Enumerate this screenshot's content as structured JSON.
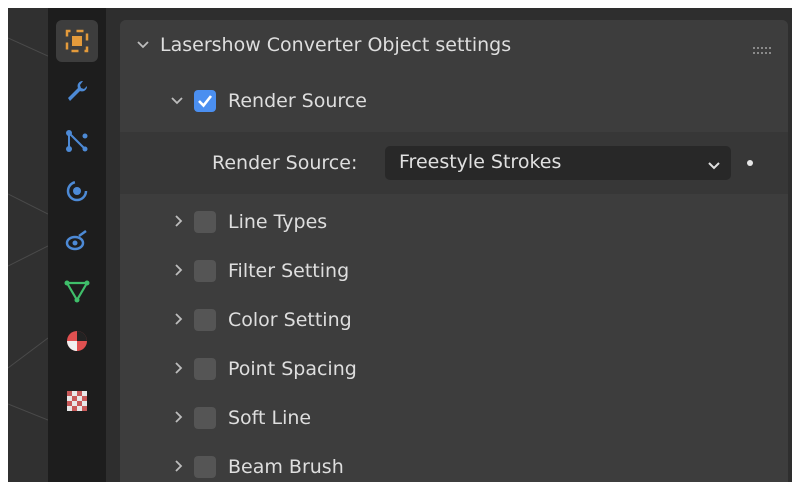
{
  "tabs": [
    {
      "name": "object",
      "icon": "object-orange-square-icon",
      "color": "#e39a3b",
      "active": true
    },
    {
      "name": "modifiers",
      "icon": "wrench-icon",
      "color": "#4d8ad6",
      "active": false
    },
    {
      "name": "particles",
      "icon": "particles-icon",
      "color": "#4d8ad6",
      "active": false
    },
    {
      "name": "physics",
      "icon": "physics-icon",
      "color": "#4d8ad6",
      "active": false
    },
    {
      "name": "constraints",
      "icon": "constraints-icon",
      "color": "#4d8ad6",
      "active": false
    },
    {
      "name": "data",
      "icon": "mesh-data-triangle-icon",
      "color": "#3fbf6a",
      "active": false
    },
    {
      "name": "material",
      "icon": "material-sphere-icon",
      "color": "#e05050",
      "active": false
    },
    {
      "name": "texture",
      "icon": "texture-checker-icon",
      "color": "#c85a5a",
      "active": false
    }
  ],
  "panel": {
    "title": "Lasershow Converter Object settings"
  },
  "render_source": {
    "section_label": "Render Source",
    "checked": true,
    "field_label": "Render Source:",
    "field_value": "Freestyle Strokes"
  },
  "subpanels": [
    {
      "label": "Line Types",
      "checked": false
    },
    {
      "label": "Filter Setting",
      "checked": false
    },
    {
      "label": "Color Setting",
      "checked": false
    },
    {
      "label": "Point Spacing",
      "checked": false
    },
    {
      "label": "Soft Line",
      "checked": false
    },
    {
      "label": "Beam Brush",
      "checked": false
    }
  ],
  "colors": {
    "accent": "#4b8ff0",
    "panel": "#3d3d3d",
    "tabbar": "#1d1d1d"
  }
}
